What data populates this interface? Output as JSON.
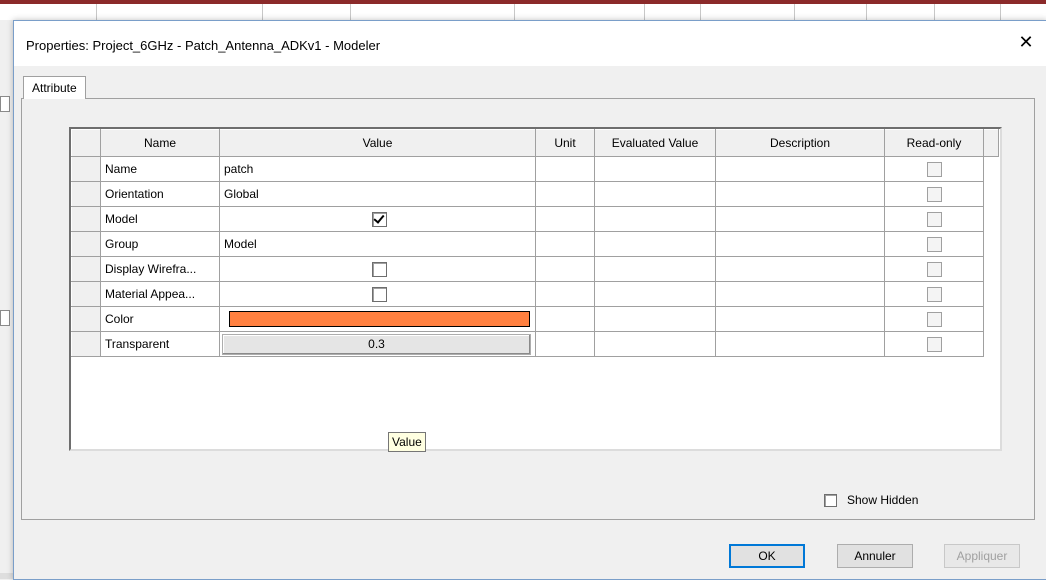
{
  "dialog": {
    "title": "Properties: Project_6GHz - Patch_Antenna_ADKv1 - Modeler",
    "close_glyph": "✕"
  },
  "tabs": [
    {
      "label": "Attribute",
      "active": true
    }
  ],
  "table": {
    "headers": [
      "Name",
      "Value",
      "Unit",
      "Evaluated Value",
      "Description",
      "Read-only"
    ],
    "rows": [
      {
        "name": "Name",
        "value": "patch",
        "type": "text",
        "readonly": false
      },
      {
        "name": "Orientation",
        "value": "Global",
        "type": "text",
        "readonly": false
      },
      {
        "name": "Model",
        "value": "",
        "type": "checkbox",
        "checked": true,
        "readonly": false
      },
      {
        "name": "Group",
        "value": "Model",
        "type": "text",
        "readonly": false
      },
      {
        "name": "Display Wirefra...",
        "value": "",
        "type": "checkbox",
        "checked": false,
        "readonly": false
      },
      {
        "name": "Material Appea...",
        "value": "",
        "type": "checkbox",
        "checked": false,
        "readonly": false
      },
      {
        "name": "Color",
        "value": "",
        "type": "color",
        "color": "#ff8040",
        "readonly": false
      },
      {
        "name": "Transparent",
        "value": "0.3",
        "type": "button",
        "readonly": false
      }
    ]
  },
  "tooltip": {
    "text": "Value"
  },
  "show_hidden": {
    "label": "Show Hidden",
    "checked": false
  },
  "buttons": {
    "ok": "OK",
    "cancel": "Annuler",
    "apply": "Appliquer"
  },
  "colors": {
    "accent": "#0078d7",
    "swatch": "#ff8040"
  }
}
